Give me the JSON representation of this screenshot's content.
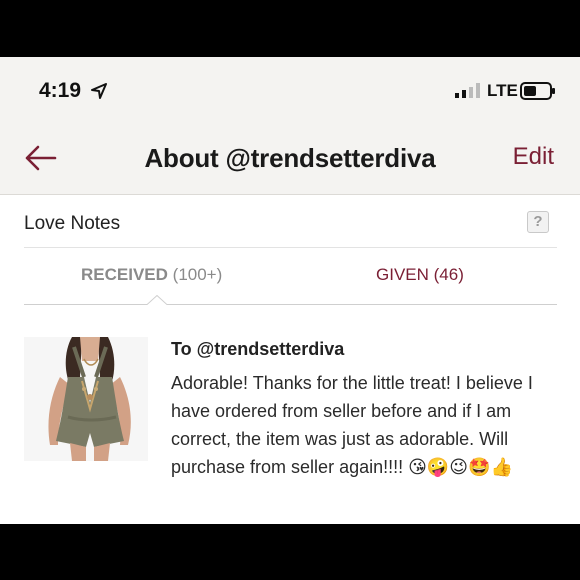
{
  "status_bar": {
    "time": "4:19",
    "network": "LTE",
    "icons": [
      "location-arrow-icon",
      "signal-bars-icon",
      "battery-icon"
    ]
  },
  "nav": {
    "title": "About @trendsetterdiva",
    "edit_label": "Edit",
    "back_icon": "back-arrow-icon"
  },
  "section": {
    "title": "Love Notes",
    "help_label": "?"
  },
  "tabs": {
    "received_label": "RECEIVED",
    "received_count": "(100+)",
    "given_label": "GIVEN (46)"
  },
  "note": {
    "to": "To @trendsetterdiva",
    "text": "Adorable! Thanks for the little treat! I believe I have ordered from seller before and if I am correct, the item was just as adorable. Will purchase from seller again!!!! 😘🤪😉🤩👍"
  },
  "colors": {
    "accent": "#7a1f34",
    "header_bg": "#f4f3f1",
    "muted_text": "#8a8a8a",
    "frame": "#000000"
  }
}
